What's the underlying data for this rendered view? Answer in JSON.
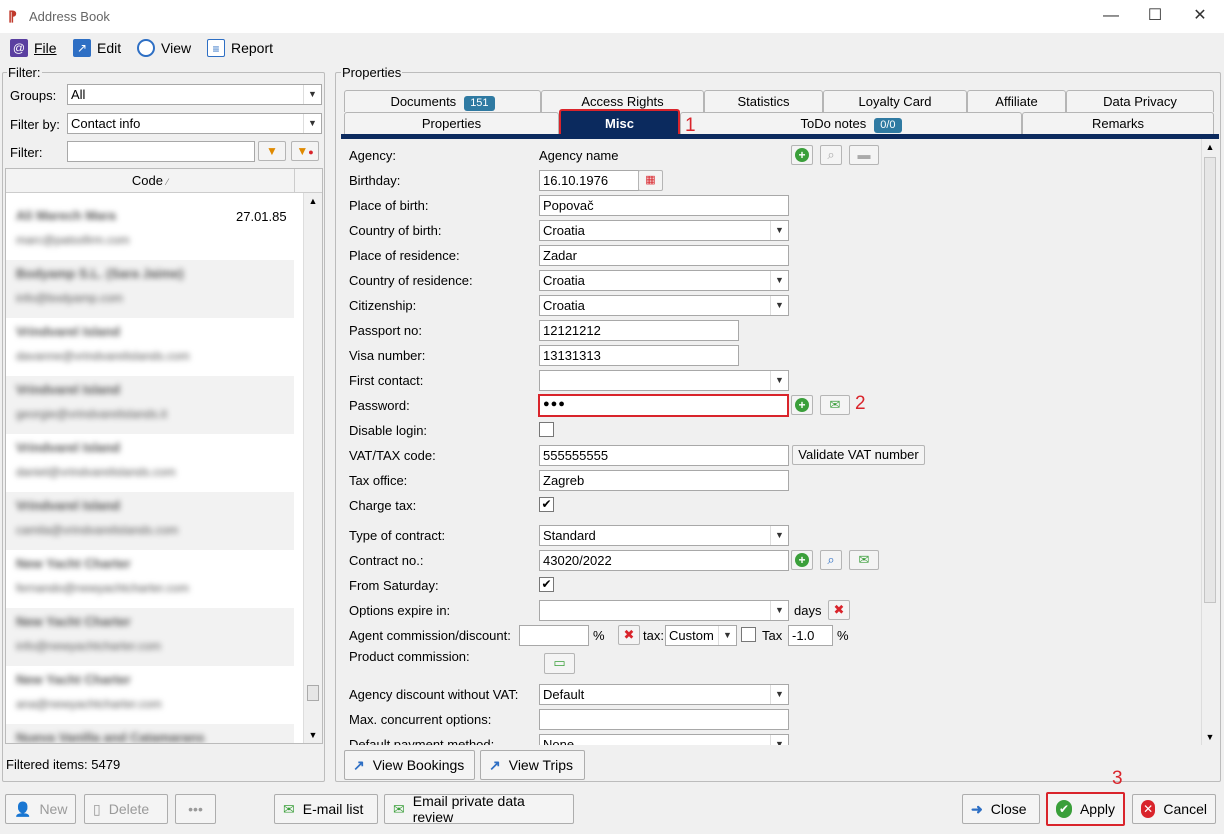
{
  "window": {
    "title": "Address Book",
    "app_icon": "app-logo"
  },
  "menu": [
    {
      "label": "File",
      "icon": "address-book-icon"
    },
    {
      "label": "Edit",
      "icon": "edit-arrow-icon"
    },
    {
      "label": "View",
      "icon": "magnifier-icon"
    },
    {
      "label": "Report",
      "icon": "clipboard-icon"
    }
  ],
  "filter": {
    "title": "Filter:",
    "groups_label": "Groups:",
    "groups_value": "All",
    "filter_by_label": "Filter by:",
    "filter_by_value": "Contact info",
    "filter_label": "Filter:",
    "filter_value": "",
    "column_header": "Code",
    "first_row_date": "27.01.85",
    "rows": [
      {
        "name": "Ali Marech Mara",
        "email": "marc@patssfirm.com"
      },
      {
        "name": "Bodyamp S.L. (Sara Jaime)",
        "email": "info@bodyamp.com"
      },
      {
        "name": "Vrindvarel Island",
        "email": "davanne@vrindvarelislands.com"
      },
      {
        "name": "Vrindvarel Island",
        "email": "georgie@vrindvarelislands.it"
      },
      {
        "name": "Vrindvarel Island",
        "email": "daniel@vrindvarelislands.com"
      },
      {
        "name": "Vrindvarel Island",
        "email": "camila@vrindvarelislands.com"
      },
      {
        "name": "New Yacht Charter",
        "email": "fernando@newyachtcharter.com"
      },
      {
        "name": "New Yacht Charter",
        "email": "info@newyachtcharter.com"
      },
      {
        "name": "New Yacht Charter",
        "email": "ana@newyachtcharter.com"
      },
      {
        "name": "Nueva Vanilla and Catamarans",
        "email": ""
      }
    ],
    "filtered_label": "Filtered items:",
    "filtered_count": "5479"
  },
  "properties": {
    "title": "Properties",
    "tabs_row1": [
      {
        "label": "Documents",
        "badge": "151"
      },
      {
        "label": "Access Rights"
      },
      {
        "label": "Statistics"
      },
      {
        "label": "Loyalty Card"
      },
      {
        "label": "Affiliate"
      },
      {
        "label": "Data Privacy"
      }
    ],
    "tabs_row2": [
      {
        "label": "Properties"
      },
      {
        "label": "Misc",
        "active": true
      },
      {
        "label": "ToDo notes",
        "badge": "0/0"
      },
      {
        "label": "Remarks"
      }
    ],
    "fields": {
      "agency_label": "Agency:",
      "agency_value": "Agency name",
      "birthday_label": "Birthday:",
      "birthday_value": "16.10.1976",
      "place_of_birth_label": "Place of birth:",
      "place_of_birth_value": "Popovač",
      "country_of_birth_label": "Country of birth:",
      "country_of_birth_value": "Croatia",
      "place_of_residence_label": "Place of residence:",
      "place_of_residence_value": "Zadar",
      "country_of_residence_label": "Country of residence:",
      "country_of_residence_value": "Croatia",
      "citizenship_label": "Citizenship:",
      "citizenship_value": "Croatia",
      "passport_label": "Passport no:",
      "passport_value": "12121212",
      "visa_label": "Visa number:",
      "visa_value": "13131313",
      "first_contact_label": "First contact:",
      "first_contact_value": "",
      "password_label": "Password:",
      "password_value": "●●●",
      "disable_login_label": "Disable login:",
      "disable_login_checked": false,
      "vat_label": "VAT/TAX code:",
      "vat_value": "555555555",
      "validate_vat_label": "Validate VAT number",
      "tax_office_label": "Tax office:",
      "tax_office_value": "Zagreb",
      "charge_tax_label": "Charge tax:",
      "charge_tax_checked": true,
      "contract_type_label": "Type of contract:",
      "contract_type_value": "Standard",
      "contract_no_label": "Contract no.:",
      "contract_no_value": "43020/2022",
      "from_saturday_label": "From Saturday:",
      "from_saturday_checked": true,
      "options_expire_label": "Options expire in:",
      "options_expire_value": "",
      "days_label": "days",
      "agent_commission_label": "Agent commission/discount:",
      "agent_commission_value": "",
      "percent_sign": "%",
      "tax_label": "tax:",
      "tax_value": "Custom",
      "tax_check_label": "Tax",
      "tax_rate_value": "-1.0",
      "tax_percent_sign": "%",
      "product_commission_label": "Product commission:",
      "agency_discount_label": "Agency discount without VAT:",
      "agency_discount_value": "Default",
      "max_options_label": "Max. concurrent options:",
      "max_options_value": "",
      "default_payment_label": "Default payment method:",
      "default_payment_value": "None"
    },
    "view_bookings_label": "View Bookings",
    "view_trips_label": "View Trips"
  },
  "bottom": {
    "new_label": "New",
    "delete_label": "Delete",
    "more_label": "•••",
    "email_list_label": "E-mail list",
    "email_private_label": "Email private data review",
    "close_label": "Close",
    "apply_label": "Apply",
    "cancel_label": "Cancel"
  },
  "annotations": [
    "1",
    "2",
    "3"
  ],
  "colors": {
    "active_tab": "#0b2a5e",
    "highlight": "#d9242b",
    "badge": "#2f7aa2",
    "green": "#3a9f3a"
  }
}
